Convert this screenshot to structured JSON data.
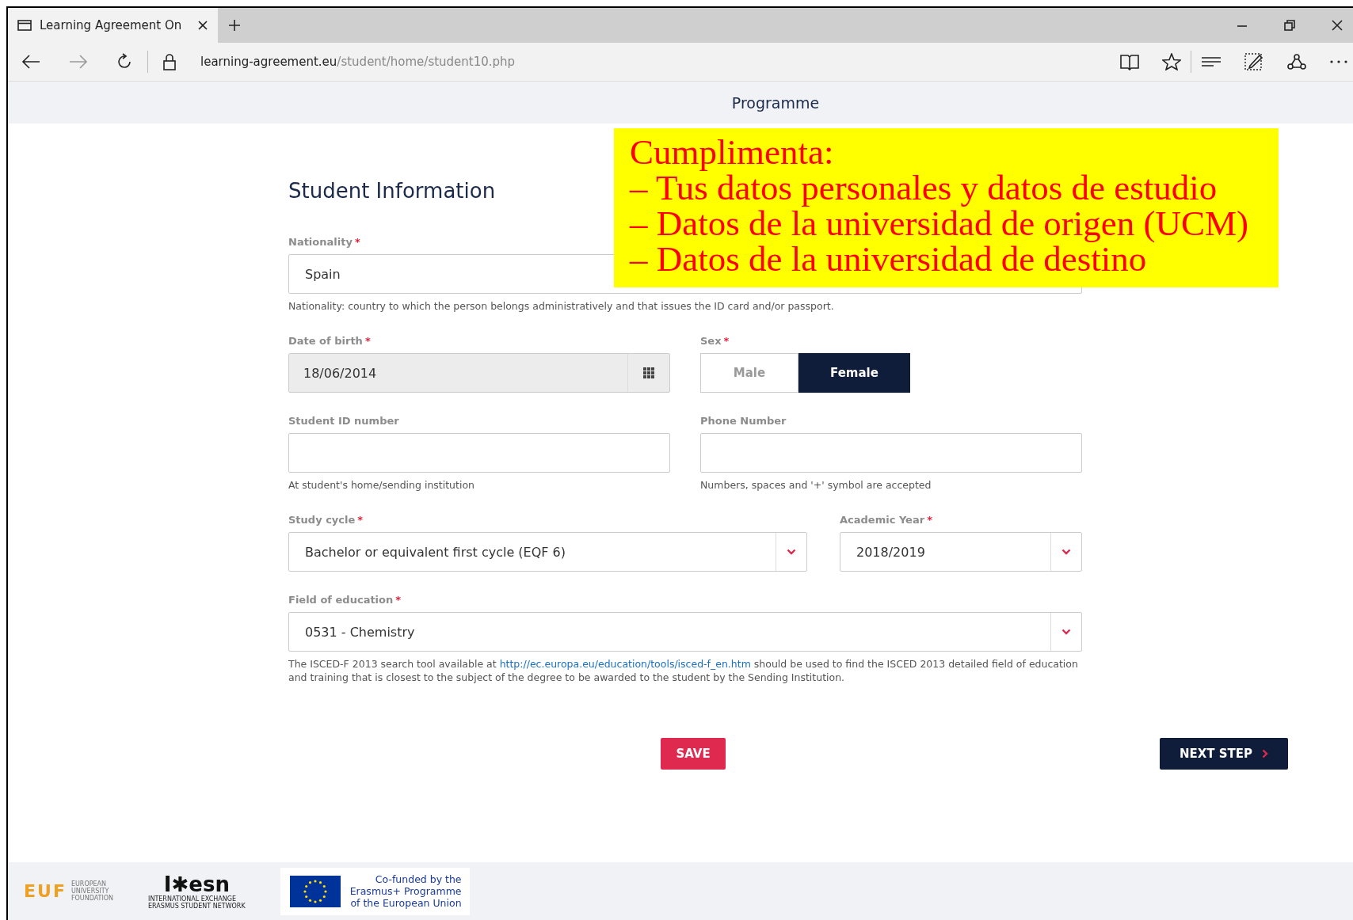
{
  "browser": {
    "tab_title": "Learning Agreement On",
    "url_host": "learning-agreement.eu",
    "url_path": "/student/home/student10.php"
  },
  "page_header": {
    "text": "Programme"
  },
  "annotation": {
    "lines": [
      "Cumplimenta:",
      "– Tus datos personales y datos de estudio",
      "– Datos de la universidad de origen (UCM)",
      "– Datos de la universidad de destino"
    ]
  },
  "section_title": "Student Information",
  "rows": [
    {
      "fields": [
        {
          "kind": "text",
          "label": "Nationality",
          "required_mark": "*",
          "value": "Spain",
          "help": "Nationality: country to which the person belongs administratively and that issues the ID card and/or passport."
        }
      ]
    },
    {
      "fields": [
        {
          "kind": "date",
          "label": "Date of birth",
          "required_mark": "*",
          "value": "18/06/2014"
        },
        {
          "kind": "toggle",
          "label": "Sex",
          "required_mark": "*",
          "options": [
            {
              "label": "Male",
              "selected": false
            },
            {
              "label": "Female",
              "selected": true
            }
          ]
        }
      ]
    },
    {
      "fields": [
        {
          "kind": "text",
          "label": "Student ID number",
          "help": "At student's home/sending institution"
        },
        {
          "kind": "text",
          "label": "Phone Number",
          "help": "Numbers, spaces and '+' symbol are accepted"
        }
      ]
    },
    {
      "fields": [
        {
          "kind": "select",
          "label": "Study cycle",
          "required_mark": "*",
          "value": "Bachelor or equivalent first cycle (EQF 6)"
        },
        {
          "kind": "select",
          "label": "Academic Year",
          "required_mark": "*",
          "value": "2018/2019"
        }
      ]
    },
    {
      "fields": [
        {
          "kind": "select",
          "label": "Field of education",
          "required_mark": "*",
          "value": "0531 - Chemistry",
          "help": "The ISCED-F 2013 search tool available at ",
          "help_link": "http://ec.europa.eu/education/tools/isced-f_en.htm",
          "help_after": " should be used to find the ISCED 2013 detailed field of education and training that is closest to the subject of the degree to be awarded to the student by the Sending Institution."
        }
      ]
    }
  ],
  "buttons": {
    "save": "SAVE",
    "next": "NEXT STEP"
  },
  "footer": {
    "euf": {
      "mark": "EUF",
      "lines": [
        "EUROPEAN",
        "UNIVERSITY",
        "FOUNDATION"
      ]
    },
    "esn": {
      "mark": "I✱esn",
      "lines": [
        "INTERNATIONAL EXCHANGE",
        "ERASMUS STUDENT NETWORK"
      ]
    },
    "eu": {
      "lines": [
        "Co-funded by the",
        "Erasmus+ Programme",
        "of the European Union"
      ]
    }
  }
}
